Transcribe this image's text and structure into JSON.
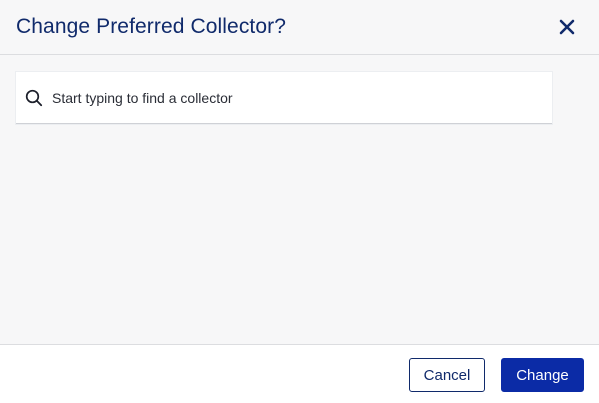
{
  "dialog": {
    "title": "Change Preferred Collector?",
    "close_icon": "close-icon"
  },
  "search": {
    "placeholder": "Start typing to find a collector",
    "value": "",
    "icon": "search-icon"
  },
  "footer": {
    "cancel_label": "Cancel",
    "change_label": "Change"
  },
  "colors": {
    "title": "#102a6b",
    "primary_button": "#0b2ba6",
    "background": "#f7f7f8"
  }
}
